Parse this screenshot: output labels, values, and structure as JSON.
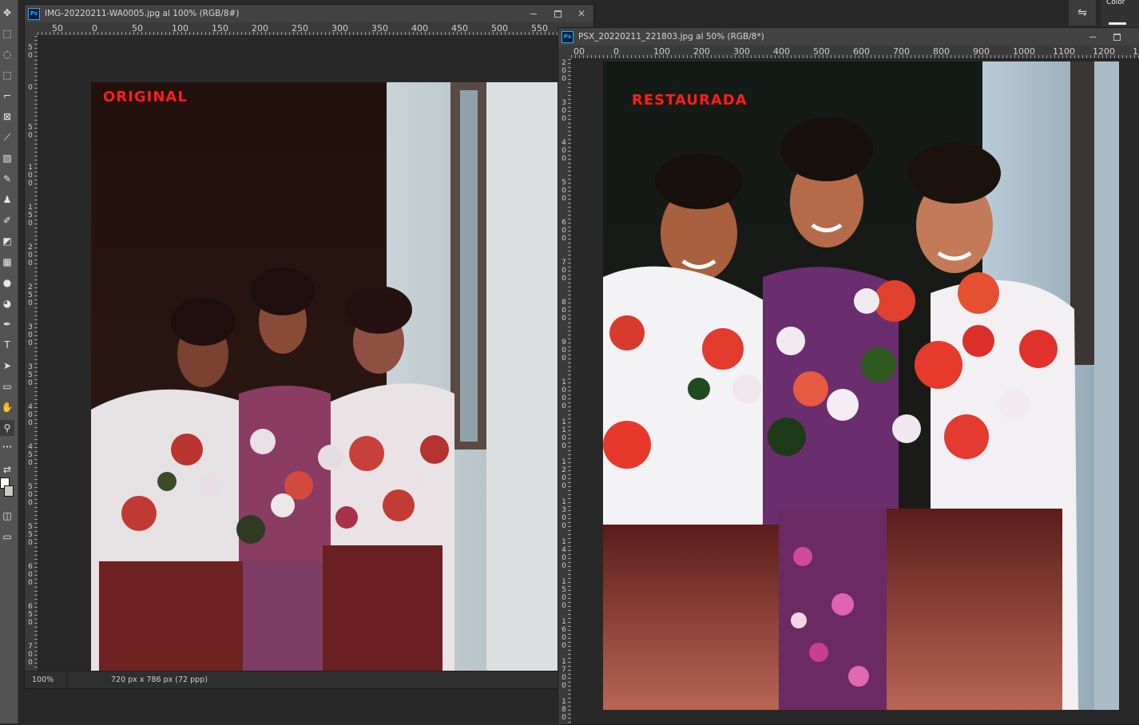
{
  "tools": [
    {
      "icon": "move-icon",
      "glyph": "✥"
    },
    {
      "icon": "marquee-icon",
      "glyph": "⬚"
    },
    {
      "icon": "lasso-icon",
      "glyph": "◌"
    },
    {
      "icon": "object-select-icon",
      "glyph": "⬚"
    },
    {
      "icon": "crop-icon",
      "glyph": "⌐"
    },
    {
      "icon": "frame-icon",
      "glyph": "⊠"
    },
    {
      "icon": "eyedropper-icon",
      "glyph": "⟋"
    },
    {
      "icon": "healing-brush-icon",
      "glyph": "▨"
    },
    {
      "icon": "brush-icon",
      "glyph": "✎"
    },
    {
      "icon": "clone-stamp-icon",
      "glyph": "♟"
    },
    {
      "icon": "history-brush-icon",
      "glyph": "✐"
    },
    {
      "icon": "eraser-icon",
      "glyph": "◩"
    },
    {
      "icon": "gradient-icon",
      "glyph": "▦"
    },
    {
      "icon": "blur-icon",
      "glyph": "●"
    },
    {
      "icon": "dodge-icon",
      "glyph": "◕"
    },
    {
      "icon": "pen-icon",
      "glyph": "✒"
    },
    {
      "icon": "type-icon",
      "glyph": "T"
    },
    {
      "icon": "path-select-icon",
      "glyph": "➤"
    },
    {
      "icon": "rectangle-icon",
      "glyph": "▭"
    },
    {
      "icon": "hand-icon",
      "glyph": "✋"
    },
    {
      "icon": "zoom-icon",
      "glyph": "⚲"
    },
    {
      "icon": "more-tools-icon",
      "glyph": "•••"
    },
    {
      "icon": "swap-colors-icon",
      "glyph": "⇄"
    },
    {
      "icon": "quick-mask-icon",
      "glyph": "◫"
    },
    {
      "icon": "screen-mode-icon",
      "glyph": "▭"
    }
  ],
  "panel": {
    "toggle_glyph": "⇋",
    "tab_label": "Color"
  },
  "window1": {
    "app_badge": "Ps",
    "title": "IMG-20220211-WA0005.jpg al 100% (RGB/8#)",
    "ruler_h": [
      "50",
      "0",
      "50",
      "100",
      "150",
      "200",
      "250",
      "300",
      "350",
      "400",
      "450",
      "500",
      "550"
    ],
    "ruler_v": [
      "5\n0",
      "0",
      "5\n0",
      "1\n0\n0",
      "1\n5\n0",
      "2\n0\n0",
      "2\n5\n0",
      "3\n0\n0",
      "3\n5\n0",
      "4\n0\n0",
      "4\n5\n0",
      "5\n0\n0",
      "5\n5\n0",
      "6\n0\n0",
      "6\n5\n0",
      "7\n0\n0"
    ],
    "photo_label": "ORIGINAL",
    "status_zoom": "100%",
    "status_info": "720 px x 786 px (72 ppp)",
    "status_arrow": "〉"
  },
  "window2": {
    "app_badge": "Ps",
    "title": "PSX_20220211_221803.jpg al 50% (RGB/8*)",
    "ruler_h": [
      "00",
      "0",
      "100",
      "200",
      "300",
      "400",
      "500",
      "600",
      "700",
      "800",
      "900",
      "1000",
      "1100",
      "1200",
      "130"
    ],
    "ruler_v": [
      "2\n0\n0",
      "3\n0\n0",
      "4\n0\n0",
      "5\n0\n0",
      "6\n0\n0",
      "7\n0\n0",
      "8\n0\n0",
      "9\n0\n0",
      "1\n0\n0\n0",
      "1\n1\n0\n0",
      "1\n2\n0\n0",
      "1\n3\n0\n0",
      "1\n4\n0\n0",
      "1\n5\n0\n0",
      "1\n6\n0\n0",
      "1\n7\n0\n0",
      "1\n8\n0"
    ],
    "photo_label": "RESTAURADA"
  },
  "colors": {
    "label_red": "#ff1f14",
    "ps_blue": "#31a8ff"
  }
}
